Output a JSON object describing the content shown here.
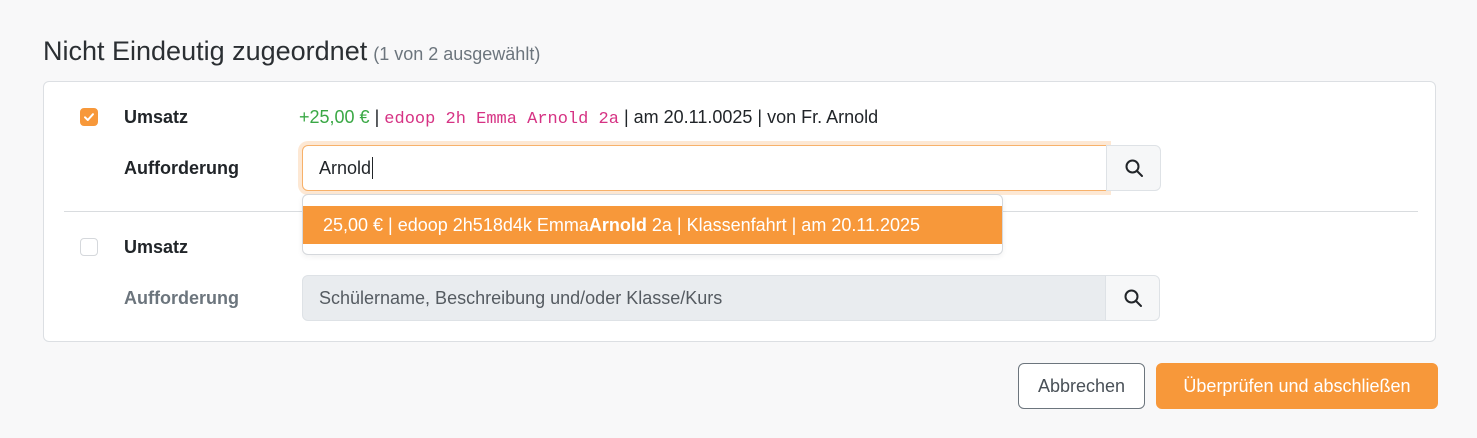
{
  "heading": {
    "title": "Nicht Eindeutig zugeordnet",
    "subtitle": "(1 von 2 ausgewählt)"
  },
  "rows": [
    {
      "checked": true,
      "umsatz_label": "Umsatz",
      "amount": "+25,00 €",
      "sep1": "|",
      "code": "edoop 2h Emma Arnold 2a",
      "rest": "| am 20.11.0025 | von Fr. Arnold",
      "aufforderung_label": "Aufforderung",
      "input_value": "Arnold"
    },
    {
      "checked": false,
      "umsatz_label": "Umsatz",
      "aufforderung_label": "Aufforderung",
      "input_placeholder": "Schülername, Beschreibung und/oder Klasse/Kurs"
    }
  ],
  "dropdown": {
    "item_pre": "25,00 € | edoop 2h518d4k Emma ",
    "item_bold": "Arnold",
    "item_post": " 2a | Klassenfahrt | am 20.11.2025"
  },
  "buttons": {
    "cancel": "Abbrechen",
    "submit": "Überprüfen und abschließen"
  },
  "icons": {
    "check": "check-icon",
    "search": "search-icon"
  },
  "colors": {
    "accent": "#f7983a",
    "amount": "#3aa845",
    "code": "#d63384"
  }
}
